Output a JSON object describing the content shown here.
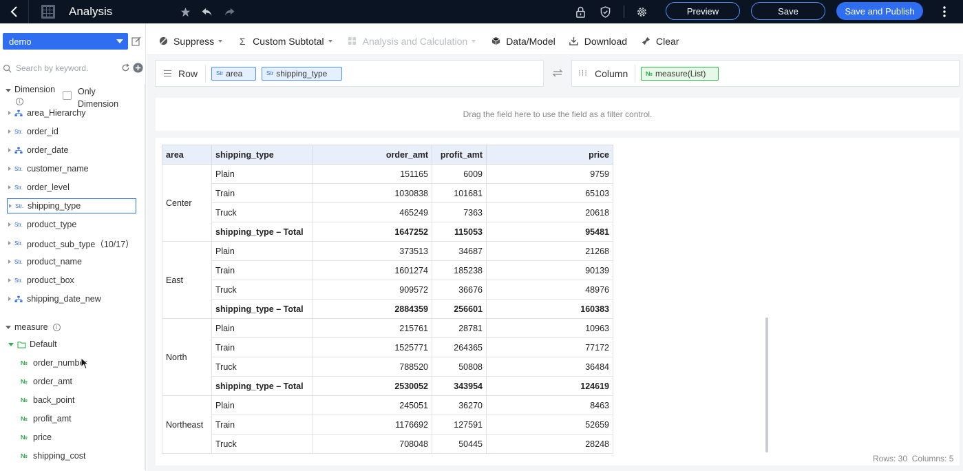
{
  "topbar": {
    "title": "Analysis",
    "preview_label": "Preview",
    "save_label": "Save",
    "publish_label": "Save and Publish"
  },
  "sidebar": {
    "dataset": "demo",
    "search_placeholder": "Search by keyword.",
    "dimension_label": "Dimension",
    "only_dimension_label": "Only Dimension",
    "dimensions": [
      {
        "type": "hier",
        "label": "area_Hierarchy"
      },
      {
        "type": "str",
        "label": "order_id"
      },
      {
        "type": "hier",
        "label": "order_date"
      },
      {
        "type": "str",
        "label": "customer_name"
      },
      {
        "type": "str",
        "label": "order_level"
      },
      {
        "type": "str",
        "label": "shipping_type"
      },
      {
        "type": "str",
        "label": "product_type"
      },
      {
        "type": "str",
        "label": "product_sub_type（10/17）"
      },
      {
        "type": "str",
        "label": "product_name"
      },
      {
        "type": "str",
        "label": "product_box"
      },
      {
        "type": "hier",
        "label": "shipping_date_new"
      }
    ],
    "measure_label": "measure",
    "folder_label": "Default",
    "measures": [
      "order_number",
      "order_amt",
      "back_point",
      "profit_amt",
      "price",
      "shipping_cost"
    ],
    "str_tag": "Str.",
    "num_tag": "№"
  },
  "toolbar": {
    "suppress": "Suppress",
    "custom_subtotal": "Custom Subtotal",
    "analysis": "Analysis and Calculation",
    "data_model": "Data/Model",
    "download": "Download",
    "clear": "Clear"
  },
  "shelves": {
    "row_label": "Row",
    "row_pills": [
      "area",
      "shipping_type"
    ],
    "column_label": "Column",
    "column_pills": [
      "measure(List)"
    ],
    "str_tag": "Str",
    "num_tag": "№"
  },
  "filter_hint": "Drag the field here to use the field as a filter control.",
  "table": {
    "headers": [
      "area",
      "shipping_type",
      "order_amt",
      "profit_amt",
      "price"
    ],
    "groups": [
      {
        "area": "Center",
        "rows": [
          [
            "Plain",
            "151165",
            "6009",
            "9759"
          ],
          [
            "Train",
            "1030838",
            "101681",
            "65103"
          ],
          [
            "Truck",
            "465249",
            "7363",
            "20618"
          ],
          [
            "shipping_type – Total",
            "1647252",
            "115053",
            "95481"
          ]
        ]
      },
      {
        "area": "East",
        "rows": [
          [
            "Plain",
            "373513",
            "34687",
            "21268"
          ],
          [
            "Train",
            "1601274",
            "185238",
            "90139"
          ],
          [
            "Truck",
            "909572",
            "36676",
            "48976"
          ],
          [
            "shipping_type – Total",
            "2884359",
            "256601",
            "160383"
          ]
        ]
      },
      {
        "area": "North",
        "rows": [
          [
            "Plain",
            "215761",
            "28781",
            "10963"
          ],
          [
            "Train",
            "1525771",
            "264365",
            "77172"
          ],
          [
            "Truck",
            "788520",
            "50808",
            "36484"
          ],
          [
            "shipping_type – Total",
            "2530052",
            "343954",
            "124619"
          ]
        ]
      },
      {
        "area": "Northeast",
        "rows": [
          [
            "Plain",
            "245051",
            "36270",
            "8463"
          ],
          [
            "Train",
            "1176692",
            "127591",
            "52659"
          ],
          [
            "Truck",
            "708048",
            "50445",
            "28248"
          ]
        ]
      }
    ]
  },
  "footer": {
    "rows": "Rows: 30",
    "columns": "Columns: 5"
  }
}
